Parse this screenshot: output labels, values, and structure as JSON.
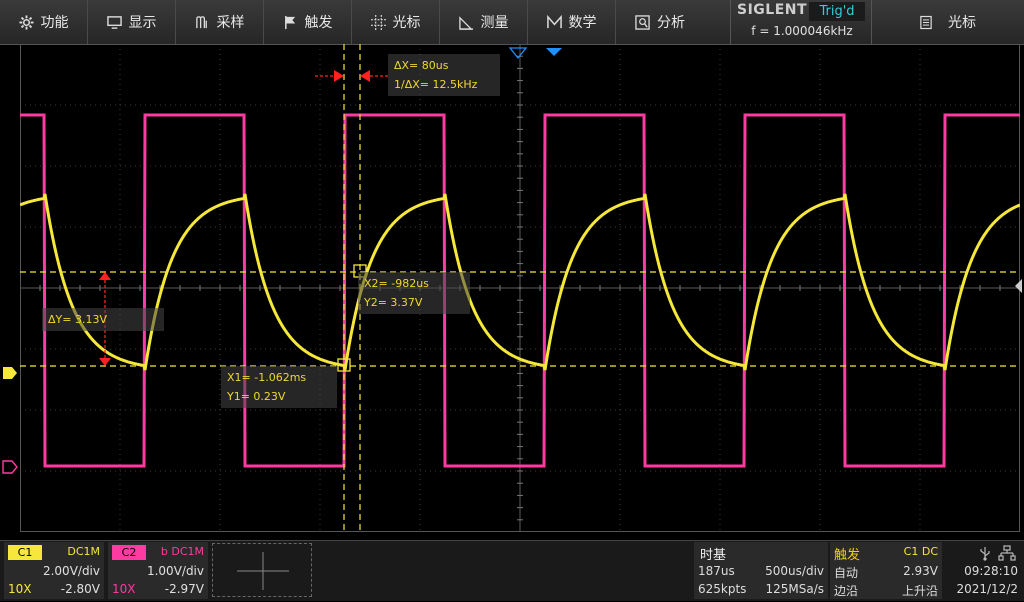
{
  "menu": {
    "items": [
      {
        "label": "功能",
        "icon": "gear-icon"
      },
      {
        "label": "显示",
        "icon": "monitor-icon"
      },
      {
        "label": "采样",
        "icon": "sampling-icon"
      },
      {
        "label": "触发",
        "icon": "flag-icon"
      },
      {
        "label": "光标",
        "icon": "crosshair-icon"
      },
      {
        "label": "测量",
        "icon": "ruler-icon"
      },
      {
        "label": "数学",
        "icon": "math-icon"
      },
      {
        "label": "分析",
        "icon": "analysis-icon"
      }
    ],
    "brand": "SIGLENT",
    "trig_status": "Trig'd",
    "frequency": "f = 1.000046kHz",
    "cursor_menu_label": "光标",
    "cursor_menu_icon": "document-icon"
  },
  "cursors": {
    "delta_x": "ΔX= 80us",
    "inv_delta_x": "1/ΔX= 12.5kHz",
    "x1": "X1= -1.062ms",
    "y1": "Y1= 0.23V",
    "x2": "X2= -982us",
    "y2": "Y2= 3.37V",
    "delta_y": "ΔY= 3.13V"
  },
  "colors": {
    "ch1": "#f5e83a",
    "ch2": "#ff3aa0",
    "cursor": "#f5e83a",
    "trigger_marker": "#1e90ff",
    "delta_arrow": "#ff2020"
  },
  "channels": [
    {
      "tag": "C1",
      "coupling": "DC1M",
      "vdiv": "2.00V/div",
      "probe": "10X",
      "offset": "-2.80V"
    },
    {
      "tag": "C2",
      "coupling": "b DC1M",
      "vdiv": "1.00V/div",
      "probe": "10X",
      "offset": "-2.97V"
    }
  ],
  "timebase": {
    "title": "时基",
    "delay": "187us",
    "tdiv": "500us/div",
    "memory": "625kpts",
    "sample_rate": "125MSa/s"
  },
  "trigger": {
    "title": "触发",
    "source": "C1 DC",
    "mode": "自动",
    "level": "2.93V",
    "type": "边沿",
    "slope": "上升沿"
  },
  "system": {
    "time": "09:28:10",
    "date": "2021/12/2",
    "usb_icon": "usb-icon",
    "network_icon": "network-icon"
  }
}
